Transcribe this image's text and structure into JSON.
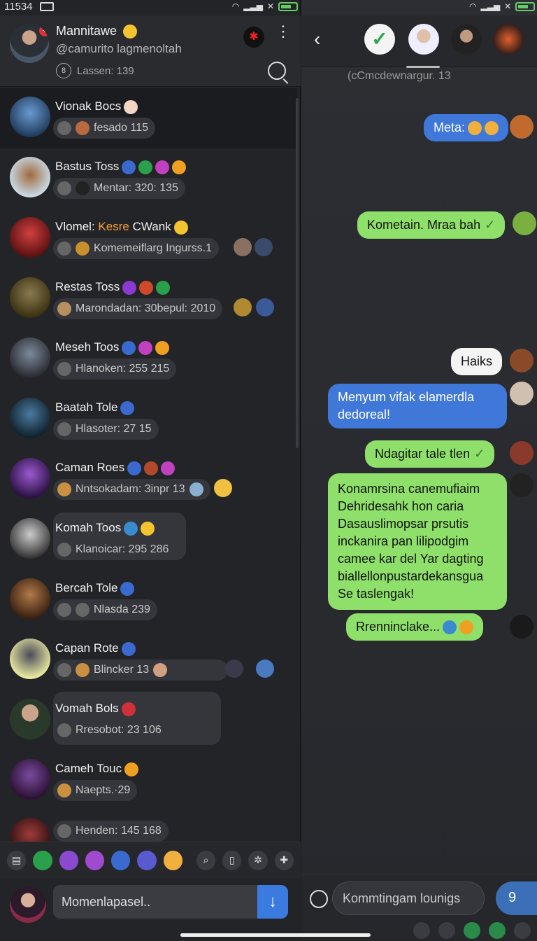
{
  "status_left": {
    "time": "11534"
  },
  "profile": {
    "name": "Mannitawe",
    "handle": "@camurito lagmenoltah",
    "lessen": "Lassen: 139",
    "badge": "+"
  },
  "chats": [
    {
      "name": "Vionak Bocs",
      "preview": "fesado 115",
      "accent": "#3a6aa0"
    },
    {
      "name": "Bastus Toss",
      "preview": "Mentar: 320: 135",
      "accent": "#4a5a70"
    },
    {
      "name_prefix": "Vlomel:",
      "name_highlight": "Kesre",
      "name_suffix": "CWank",
      "preview": "Komemeiflarg Ingurss.1",
      "accent": "#a02a2a"
    },
    {
      "name": "Restas Toss",
      "preview": "Marondadan: 30bepul: 2010",
      "accent": "#6a5a30"
    },
    {
      "name": "Meseh Toos",
      "preview": "Hlanoken: 255 215",
      "accent": "#5a4a40"
    },
    {
      "name": "Baatah Tole",
      "preview": "Hlasoter: 27 15",
      "accent": "#2a4a6a"
    },
    {
      "name": "Caman Roes",
      "preview": "Nntsokadam: 3inpr 13",
      "accent": "#5a2a7a"
    },
    {
      "name": "Komah Toos",
      "preview": "Klanoicar: 295 286",
      "accent": "#444"
    },
    {
      "name": "Bercah Tole",
      "preview": "Nlasda 239",
      "accent": "#6a4a2a"
    },
    {
      "name": "Capan Rote",
      "preview": "Blincker 13",
      "accent": "#cfd48a"
    },
    {
      "name": "Vomah Bols",
      "preview": "Rresobot: 23 106",
      "accent": "#3a5a3a"
    },
    {
      "name": "Cameh Touc",
      "preview": "Naepts.·29",
      "accent": "#6a3a8a"
    },
    {
      "name": "",
      "preview": "Henden: 145 168",
      "accent": "#4a2a2a"
    }
  ],
  "left_compose": {
    "placeholder": "Momenlapasel.."
  },
  "right": {
    "subhandle": "(cCmcdewnargur. 13",
    "messages": [
      {
        "text": "Meta:",
        "style": "blue"
      },
      {
        "text": "Kometain. Mraa bah",
        "style": "green",
        "tick": "✓"
      },
      {
        "text": "Haiks",
        "style": "white"
      },
      {
        "text": "Menyum vifak elamerdla dedoreal!",
        "style": "blue"
      },
      {
        "text": "Ndagitar tale tlen",
        "style": "green",
        "tick": "✓"
      },
      {
        "text": "Konamrsina canemufiaim Dehridesahk hon caria Dasauslimopsar prsutis inckanira pan lilipodgim camee kar del Yar dagting biallellonpustardekansgua Se taslengak!",
        "style": "green"
      },
      {
        "text": "Rrenninclake...",
        "style": "green"
      }
    ],
    "compose_placeholder": "Kommtingam lounigs",
    "send_label": "9"
  },
  "icons": {
    "back": "‹",
    "check": "✓",
    "send_arrow": "↓",
    "kebab": "⋮"
  },
  "colors": {
    "accent_blue": "#3f78d8",
    "bubble_green": "#8fe06a",
    "bg_dark": "#232427"
  }
}
